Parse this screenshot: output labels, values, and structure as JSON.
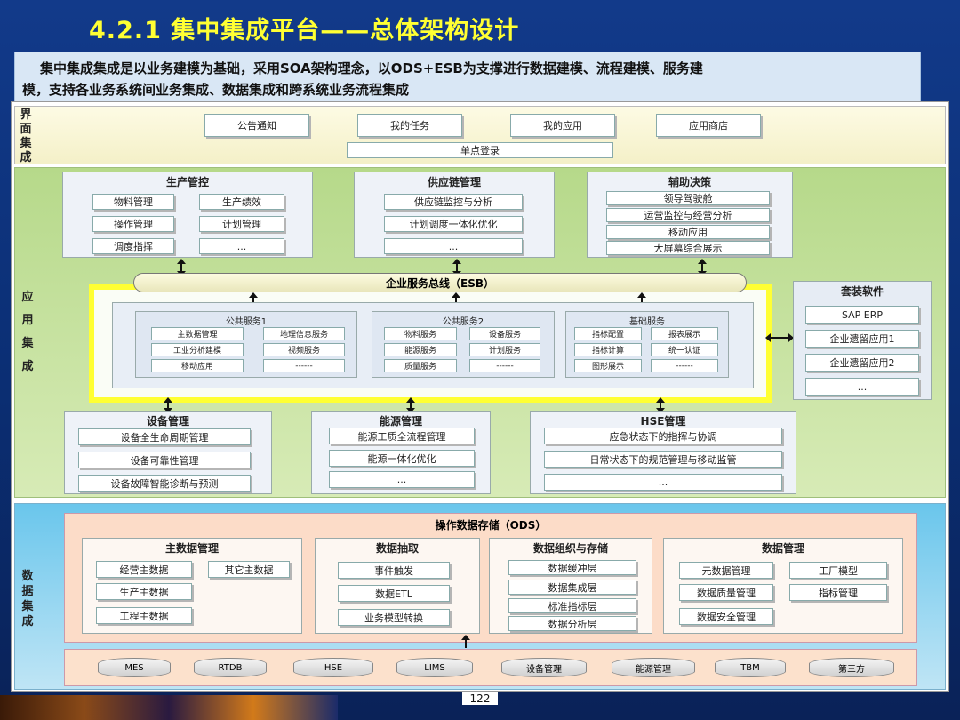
{
  "title": "4.2.1 集中集成平台——总体架构设计",
  "subtitle_line1": "集中集成集成是以业务建模为基础，采用SOA架构理念，以ODS+ESB为支撑进行数据建模、流程建模、服务建",
  "subtitle_line2": "模，支持各业务系统间业务集成、数据集成和跨系统业务流程集成",
  "page_number": "122",
  "ui_layer": {
    "label": "界面集成",
    "items": [
      "公告通知",
      "我的任务",
      "我的应用",
      "应用商店"
    ],
    "sso": "单点登录"
  },
  "app_layer": {
    "label": "应用集成",
    "production": {
      "title": "生产管控",
      "items": [
        "物料管理",
        "生产绩效",
        "操作管理",
        "计划管理",
        "调度指挥",
        "..."
      ]
    },
    "supply": {
      "title": "供应链管理",
      "items": [
        "供应链监控与分析",
        "计划调度一体化优化",
        "..."
      ]
    },
    "decision": {
      "title": "辅助决策",
      "items": [
        "领导驾驶舱",
        "运营监控与经营分析",
        "移动应用",
        "大屏幕综合展示"
      ]
    },
    "esb": "企业服务总线（ESB）",
    "public1": {
      "title": "公共服务1",
      "items": [
        "主数据管理",
        "地理信息服务",
        "工业分析建模",
        "视频服务",
        "移动应用",
        "------"
      ]
    },
    "public2": {
      "title": "公共服务2",
      "items": [
        "物料服务",
        "设备服务",
        "能源服务",
        "计划服务",
        "质量服务",
        "------"
      ]
    },
    "basic": {
      "title": "基础服务",
      "items": [
        "指标配置",
        "报表展示",
        "指标计算",
        "统一认证",
        "图形展示",
        "------"
      ]
    },
    "package": {
      "title": "套装软件",
      "items": [
        "SAP ERP",
        "企业遗留应用1",
        "企业遗留应用2",
        "..."
      ]
    },
    "equipment": {
      "title": "设备管理",
      "items": [
        "设备全生命周期管理",
        "设备可靠性管理",
        "设备故障智能诊断与预测"
      ]
    },
    "energy": {
      "title": "能源管理",
      "items": [
        "能源工质全流程管理",
        "能源一体化优化",
        "..."
      ]
    },
    "hse": {
      "title": "HSE管理",
      "items": [
        "应急状态下的指挥与协调",
        "日常状态下的规范管理与移动监管",
        "..."
      ]
    }
  },
  "data_layer": {
    "label": "数据集成",
    "ods": "操作数据存储（ODS）",
    "master": {
      "title": "主数据管理",
      "items": [
        "经营主数据",
        "其它主数据",
        "生产主数据",
        "工程主数据"
      ]
    },
    "extract": {
      "title": "数据抽取",
      "items": [
        "事件触发",
        "数据ETL",
        "业务模型转换"
      ]
    },
    "organize": {
      "title": "数据组织与存储",
      "items": [
        "数据缓冲层",
        "数据集成层",
        "标准指标层",
        "数据分析层"
      ]
    },
    "governance": {
      "title": "数据管理",
      "items": [
        "元数据管理",
        "工厂模型",
        "数据质量管理",
        "指标管理",
        "数据安全管理"
      ]
    },
    "sources": [
      "MES",
      "RTDB",
      "HSE",
      "LIMS",
      "设备管理",
      "能源管理",
      "TBM",
      "第三方"
    ]
  }
}
